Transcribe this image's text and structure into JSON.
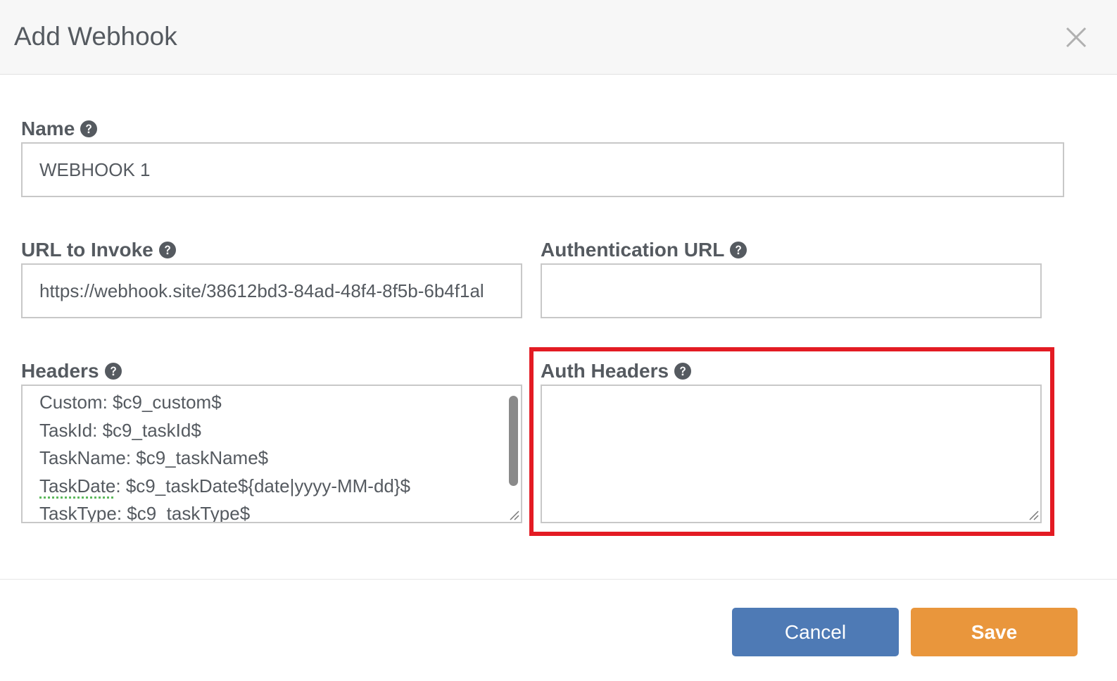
{
  "dialog": {
    "title": "Add Webhook",
    "close_icon": "close-icon"
  },
  "fields": {
    "name": {
      "label": "Name",
      "value": "WEBHOOK 1"
    },
    "url_to_invoke": {
      "label": "URL to Invoke",
      "value": "https://webhook.site/38612bd3-84ad-48f4-8f5b-6b4f1al"
    },
    "authentication_url": {
      "label": "Authentication URL",
      "value": ""
    },
    "headers": {
      "label": "Headers",
      "lines": [
        "Custom: $c9_custom$",
        "TaskId: $c9_taskId$",
        "TaskName: $c9_taskName$",
        "TaskDate",
        ": $c9_taskDate${date|yyyy-MM-dd}$",
        "TaskType: $c9_taskType$"
      ]
    },
    "auth_headers": {
      "label": "Auth Headers",
      "value": ""
    }
  },
  "footer": {
    "cancel_label": "Cancel",
    "save_label": "Save"
  },
  "colors": {
    "cancel": "#4e7ab5",
    "save": "#e9963c",
    "highlight": "#e31b23"
  },
  "icons": {
    "help": "question-circle-icon",
    "resize": "resize-handle-icon"
  }
}
